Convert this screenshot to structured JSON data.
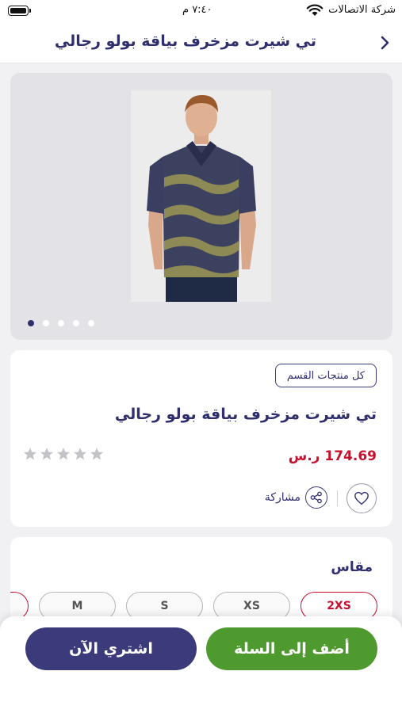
{
  "status_bar": {
    "carrier": "شركة الاتصالات",
    "time": "٧:٤٠ م"
  },
  "header": {
    "title": "تي شيرت مزخرف بياقة بولو رجالي",
    "back_icon": "chevron-right-icon"
  },
  "gallery": {
    "image_alt": "product photo - man wearing patterned polo t-shirt",
    "dots_count": 5,
    "active_dot": 0
  },
  "product": {
    "category_link": "كل منتجات القسم",
    "name": "تي شيرت مزخرف بياقة بولو رجالي",
    "price": "174.69 ر.س",
    "rating": 0,
    "rating_max": 5,
    "share_label": "مشاركة"
  },
  "sizes": {
    "title": "مقاس",
    "options": [
      "2XS",
      "XS",
      "S",
      "M"
    ],
    "selected": "2XS"
  },
  "actions": {
    "add_to_cart": "أضف إلى السلة",
    "buy_now": "اشتري الآن"
  },
  "colors": {
    "primary": "#2f2f6e",
    "price": "#c8102e",
    "cart_button": "#4e9a2f",
    "buy_button": "#3b3a7a"
  }
}
